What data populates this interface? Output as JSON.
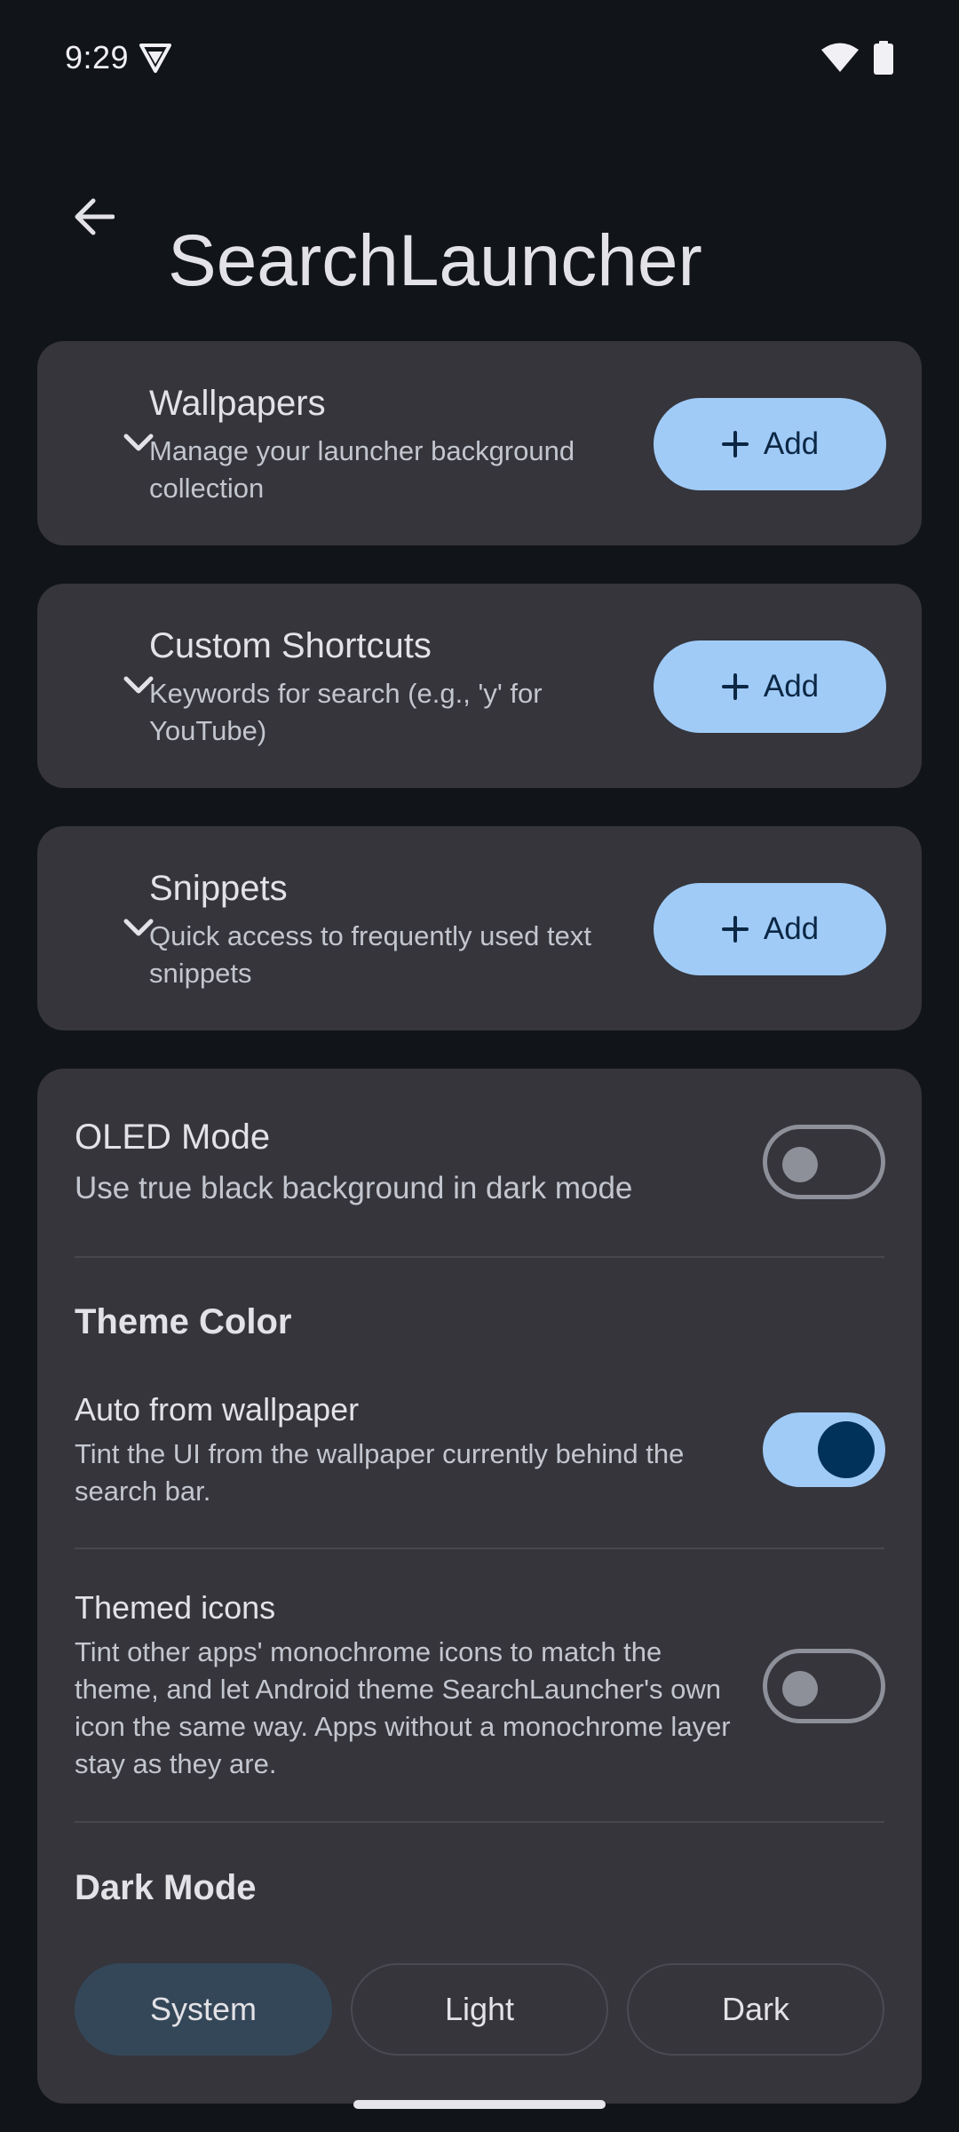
{
  "status_bar": {
    "time": "9:29",
    "icons": [
      "vpn-shield-icon",
      "wifi-icon",
      "battery-icon"
    ]
  },
  "app_bar": {
    "back_icon": "arrow-back-icon",
    "title": "SearchLauncher"
  },
  "sections": [
    {
      "title": "Wallpapers",
      "description": "Manage your launcher background collection",
      "button_label": "Add"
    },
    {
      "title": "Custom Shortcuts",
      "description": "Keywords for search (e.g., 'y' for YouTube)",
      "button_label": "Add"
    },
    {
      "title": "Snippets",
      "description": "Quick access to frequently used text snippets",
      "button_label": "Add"
    }
  ],
  "settings": {
    "oled": {
      "title": "OLED Mode",
      "description": "Use true black background in dark mode",
      "enabled": false
    },
    "theme_color": {
      "header": "Theme Color",
      "auto_wallpaper": {
        "title": "Auto from wallpaper",
        "description": "Tint the UI from the wallpaper currently behind the search bar.",
        "enabled": true
      },
      "themed_icons": {
        "title": "Themed icons",
        "description": "Tint other apps' monochrome icons to match the theme, and let Android theme SearchLauncher's own icon the same way. Apps without a monochrome layer stay as they are.",
        "enabled": false
      }
    },
    "dark_mode": {
      "header": "Dark Mode",
      "options": [
        "System",
        "Light",
        "Dark"
      ],
      "selected": "System"
    }
  },
  "colors": {
    "background": "#111418",
    "card": "#35353b",
    "accent": "#a0cbf7",
    "on_accent": "#0b2744",
    "selected_segment": "#344759"
  }
}
